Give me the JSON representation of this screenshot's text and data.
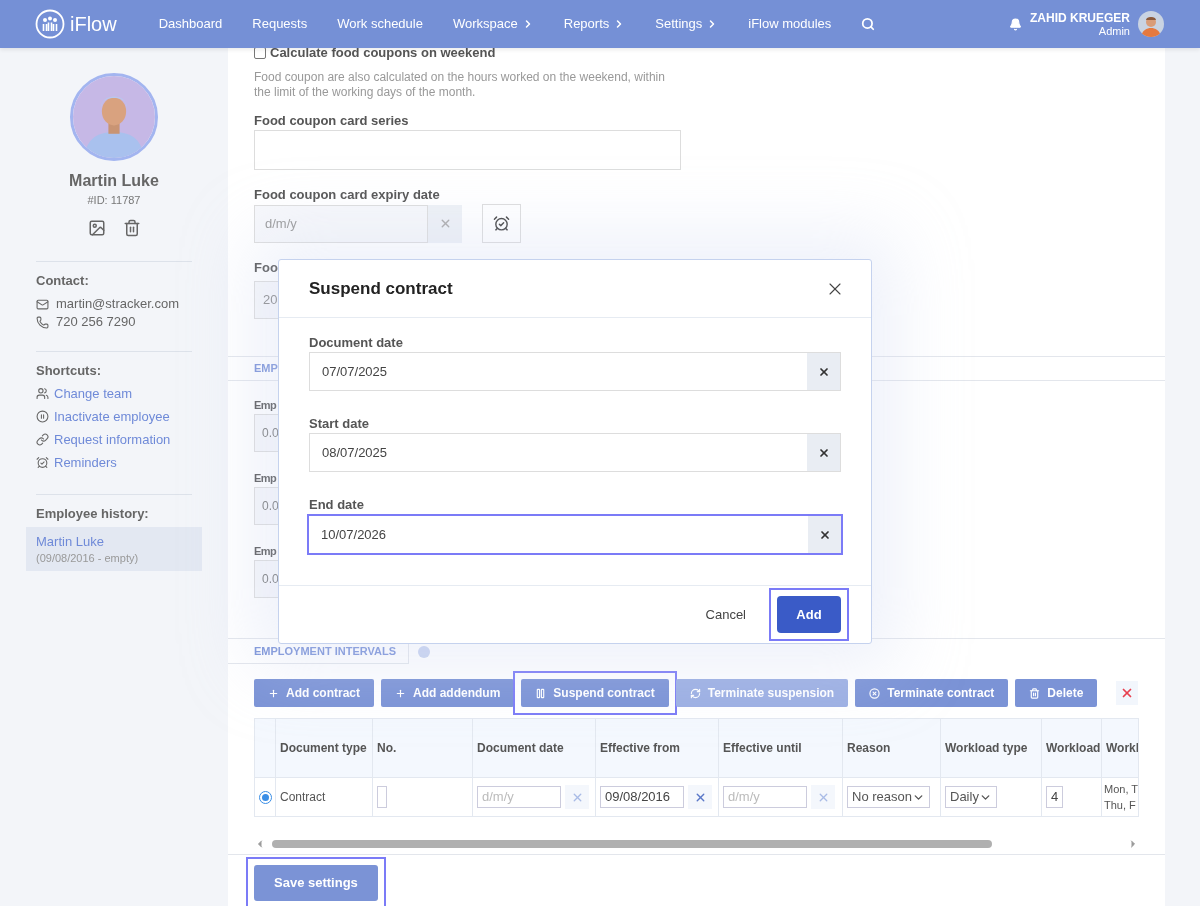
{
  "nav": {
    "logo": "iFlow",
    "items": [
      {
        "label": "Dashboard",
        "submenu": false
      },
      {
        "label": "Requests",
        "submenu": false
      },
      {
        "label": "Work schedule",
        "submenu": false
      },
      {
        "label": "Workspace",
        "submenu": true
      },
      {
        "label": "Reports",
        "submenu": true
      },
      {
        "label": "Settings",
        "submenu": true
      },
      {
        "label": "iFlow modules",
        "submenu": false
      }
    ],
    "user": {
      "name": "ZAHID KRUEGER",
      "role": "Admin"
    }
  },
  "profile": {
    "name": "Martin Luke",
    "id": "#ID: 11787",
    "contact_heading": "Contact:",
    "email": "martin@stracker.com",
    "phone": "720 256 7290",
    "shortcuts_heading": "Shortcuts:",
    "shortcuts": [
      {
        "label": "Change team",
        "kind": "team"
      },
      {
        "label": "Inactivate employee",
        "kind": "pause"
      },
      {
        "label": "Request information",
        "kind": "link"
      },
      {
        "label": "Reminders",
        "kind": "alarm"
      }
    ],
    "history_heading": "Employee history:",
    "history": [
      {
        "name": "Martin Luke",
        "period": "(09/08/2016 - empty)",
        "selected": true
      }
    ]
  },
  "form": {
    "weekend": {
      "label": "Calculate food coupons on weekend",
      "checked": false
    },
    "note": "Food coupon are also calculated on the hours worked on the weekend, within the limit of the working days of the month.",
    "series_label": "Food coupon card series",
    "expiry": {
      "label": "Food coupon card expiry date",
      "placeholder": "d/m/y"
    },
    "partial": {
      "label": "Foo",
      "value": "20"
    }
  },
  "employment_tab": "EMP",
  "employment_fields": [
    {
      "label": "Emp",
      "value": "0.0"
    },
    {
      "label": "Emp",
      "value": "0.0"
    },
    {
      "label": "Emp",
      "value": "0.0"
    }
  ],
  "intervals": {
    "tab": "EMPLOYMENT INTERVALS",
    "toolbar": [
      {
        "label": "Add contract",
        "kind": "add",
        "disabled": false,
        "highlighted": false
      },
      {
        "label": "Add addendum",
        "kind": "add",
        "disabled": false,
        "highlighted": false
      },
      {
        "label": "Suspend contract",
        "kind": "suspend",
        "disabled": false,
        "highlighted": true
      },
      {
        "label": "Terminate suspension",
        "kind": "resume",
        "disabled": true,
        "highlighted": false
      },
      {
        "label": "Terminate contract",
        "kind": "terminate",
        "disabled": false,
        "highlighted": false
      },
      {
        "label": "Delete",
        "kind": "delete",
        "disabled": false,
        "highlighted": false
      },
      {
        "kind": "cancel",
        "disabled": false,
        "highlighted": false
      }
    ],
    "columns": [
      "Document type",
      "No.",
      "Document date",
      "Effective from",
      "Effective until",
      "Reason",
      "Workload type",
      "Workload",
      "Workl"
    ],
    "rows": [
      {
        "selected": true,
        "cells": [
          {
            "kind": "text",
            "text": "Contract"
          },
          {
            "kind": "input"
          },
          {
            "kind": "date",
            "placeholder": "d/m/y"
          },
          {
            "kind": "date",
            "value": "09/08/2016"
          },
          {
            "kind": "date",
            "placeholder": "d/m/y"
          },
          {
            "kind": "select",
            "value": "No reason"
          },
          {
            "kind": "select",
            "value": "Daily"
          },
          {
            "kind": "input",
            "value": "4"
          },
          {
            "kind": "text",
            "text": "Mon, T\nThu, F"
          }
        ]
      }
    ]
  },
  "save": {
    "label": "Save settings",
    "highlighted": true
  },
  "modal": {
    "title": "Suspend contract",
    "fields": [
      {
        "label": "Document date",
        "value": "07/07/2025",
        "highlighted": false
      },
      {
        "label": "Start date",
        "value": "08/07/2025",
        "highlighted": false
      },
      {
        "label": "End date",
        "value": "10/07/2026",
        "highlighted": true
      }
    ],
    "cancel": "Cancel",
    "submit": {
      "label": "Add",
      "highlighted": true
    }
  }
}
